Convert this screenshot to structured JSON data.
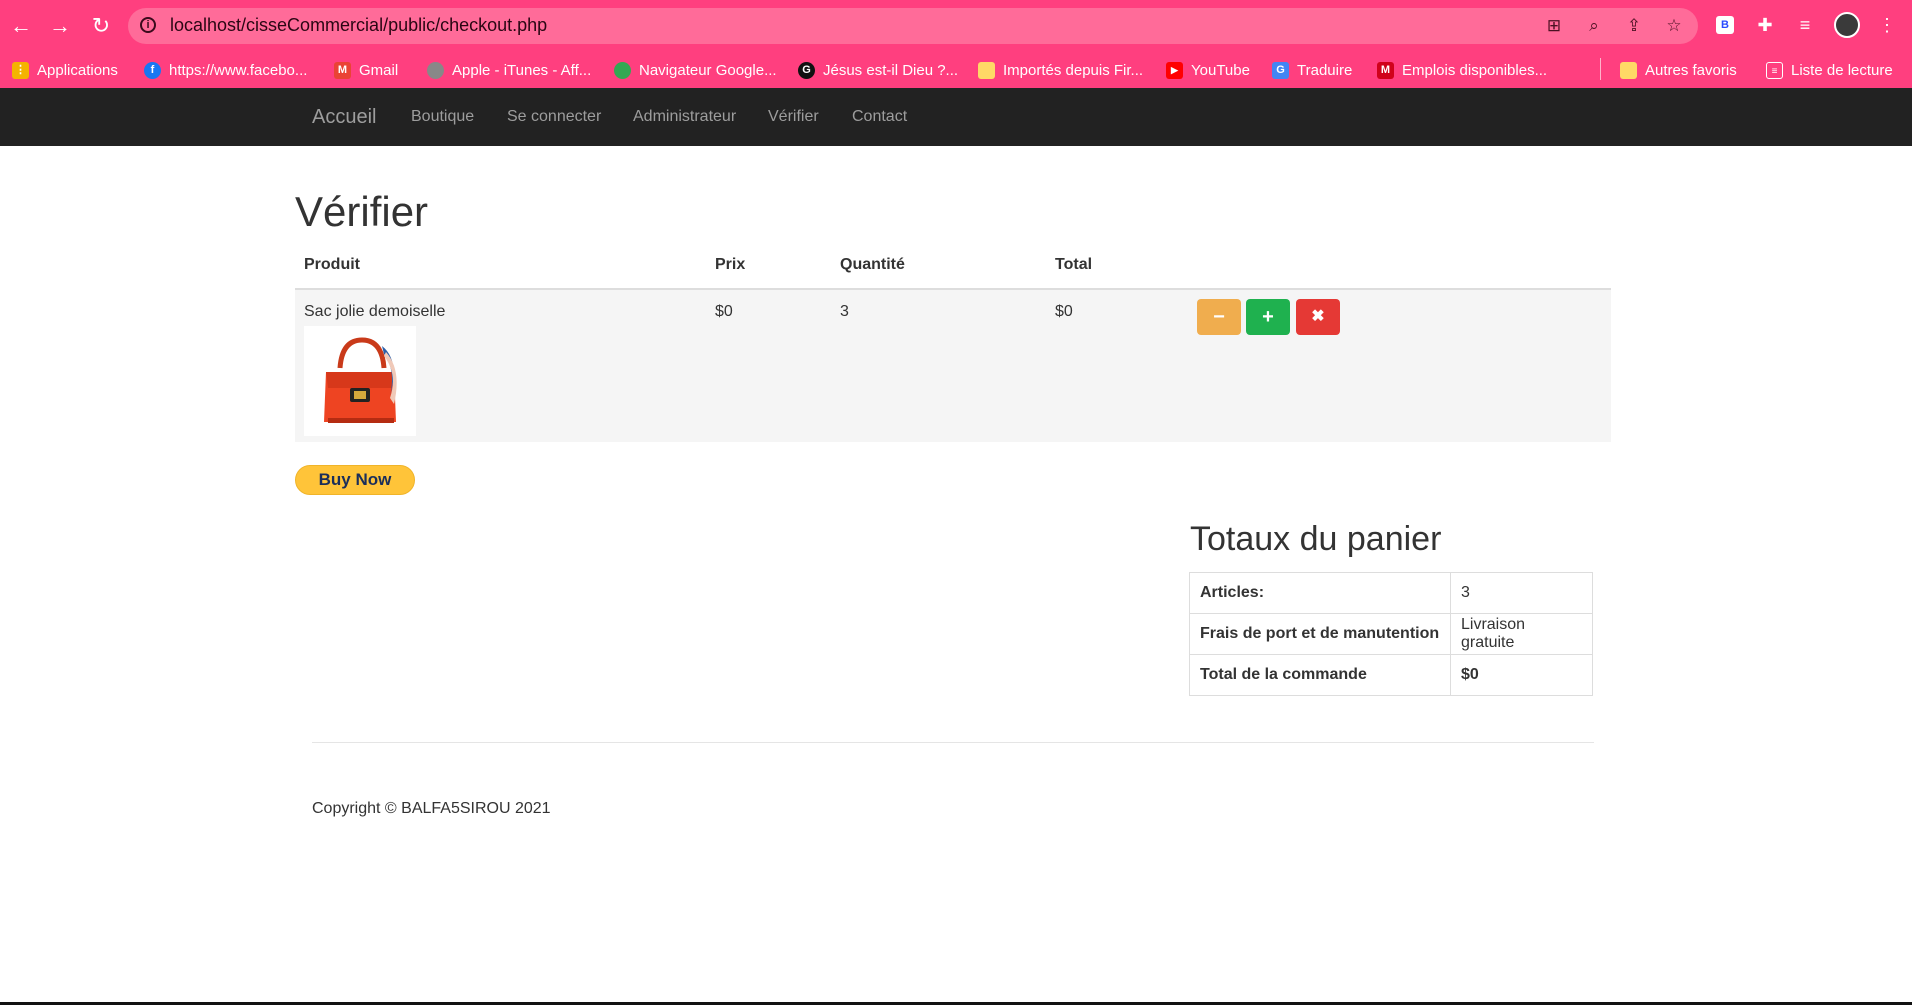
{
  "browser": {
    "url": "localhost/cisseCommercial/public/checkout.php",
    "bookmarks": [
      {
        "label": "Applications",
        "icon": "apps-grid-icon",
        "color": "#f4b400"
      },
      {
        "label": "https://www.facebo...",
        "icon": "facebook-icon",
        "color": "#1877f2"
      },
      {
        "label": "Gmail",
        "icon": "gmail-icon",
        "color": "#ea4335"
      },
      {
        "label": "Apple - iTunes - Aff...",
        "icon": "apple-icon",
        "color": "#888888"
      },
      {
        "label": "Navigateur Google...",
        "icon": "chrome-icon",
        "color": "#34a853"
      },
      {
        "label": "Jésus est-il Dieu ?...",
        "icon": "g-logo-icon",
        "color": "#111111"
      },
      {
        "label": "Importés depuis Fir...",
        "icon": "folder-icon",
        "color": "#ffd966"
      },
      {
        "label": "YouTube",
        "icon": "youtube-icon",
        "color": "#ff0000"
      },
      {
        "label": "Traduire",
        "icon": "translate-icon",
        "color": "#4285f4"
      },
      {
        "label": "Emplois disponibles...",
        "icon": "jobs-icon",
        "color": "#d0021b"
      },
      {
        "label": "Autres favoris",
        "icon": "folder-icon",
        "color": "#ffd966"
      },
      {
        "label": "Liste de lecture",
        "icon": "reading-list-icon",
        "color": "#ffffff"
      }
    ]
  },
  "navbar": {
    "brand": "Accueil",
    "links": [
      "Boutique",
      "Se connecter",
      "Administrateur",
      "Vérifier",
      "Contact"
    ]
  },
  "page": {
    "title": "Vérifier",
    "columns": [
      "Produit",
      "Prix",
      "Quantité",
      "Total"
    ],
    "rows": [
      {
        "product": "Sac jolie demoiselle",
        "price": "$0",
        "quantity": "3",
        "total": "$0"
      }
    ],
    "actions": {
      "minus": "−",
      "plus": "+",
      "remove": "✖"
    },
    "buy_now": "Buy Now"
  },
  "totals": {
    "title": "Totaux du panier",
    "rows": [
      {
        "label": "Articles:",
        "value": "3"
      },
      {
        "label": "Frais de port et de manutention",
        "value": "Livraison gratuite"
      },
      {
        "label": "Total de la commande",
        "value": "$0"
      }
    ]
  },
  "footer": {
    "copyright": "Copyright © BALFA5SIROU 2021"
  },
  "colors": {
    "browser_accent": "#ff3f7f",
    "navbar_bg": "#222222",
    "btn_warning": "#f0ad4e",
    "btn_success": "#1fb14f",
    "btn_danger": "#e53935",
    "paypal_yellow": "#ffc439"
  }
}
